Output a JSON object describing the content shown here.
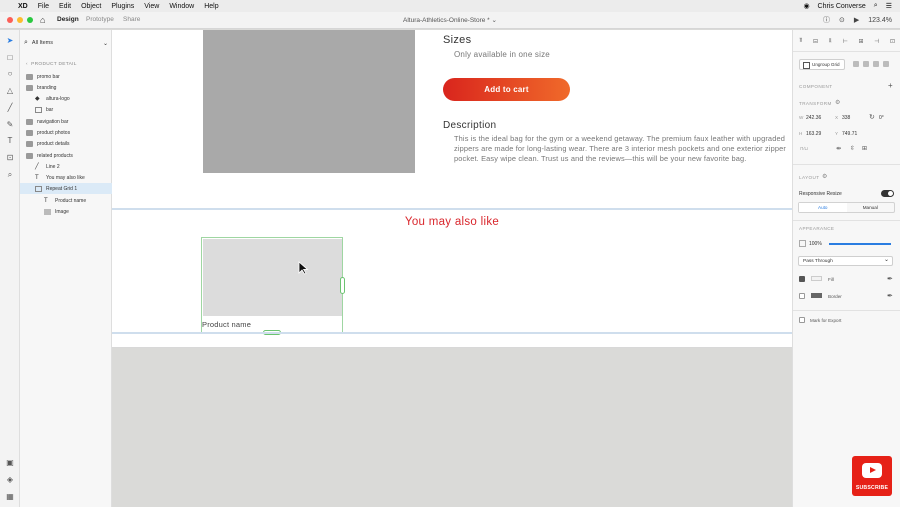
{
  "menubar": {
    "app": "XD",
    "items": [
      "File",
      "Edit",
      "Object",
      "Plugins",
      "View",
      "Window",
      "Help"
    ],
    "user": "Chris Converse"
  },
  "toolbar": {
    "tabs": [
      "Design",
      "Prototype",
      "Share"
    ],
    "document_title": "Altura-Athletics-Online-Store *",
    "zoom": "123.4%"
  },
  "layers": {
    "filter": "All Items",
    "section": "PRODUCT DETAIL",
    "items": [
      {
        "label": "promo bar",
        "type": "folder"
      },
      {
        "label": "branding",
        "type": "folder"
      },
      {
        "label": "altura-logo",
        "type": "symbol"
      },
      {
        "label": "bar",
        "type": "grid"
      },
      {
        "label": "navigation bar",
        "type": "folder"
      },
      {
        "label": "product photos",
        "type": "folder"
      },
      {
        "label": "product details",
        "type": "folder"
      },
      {
        "label": "related products",
        "type": "folder"
      },
      {
        "label": "Line 2",
        "type": "line"
      },
      {
        "label": "You may also like",
        "type": "text"
      },
      {
        "label": "Repeat Grid 1",
        "type": "grid"
      },
      {
        "label": "Product name",
        "type": "text"
      },
      {
        "label": "Image",
        "type": "image"
      }
    ]
  },
  "canvas": {
    "sizes_heading": "Sizes",
    "sizes_text": "Only available in one size",
    "cart_button": "Add to cart",
    "description_heading": "Description",
    "description_text": "This is the ideal bag for the gym or a weekend getaway.  The premium faux leather with upgraded zippers are made for long-lasting wear. There are 3 interior mesh pockets and one exterior zipper pocket. Easy wipe clean. Trust us and the reviews—this will be your new favorite bag.",
    "related_heading": "You may also like",
    "product_name": "Product name"
  },
  "props": {
    "ungroup_label": "Ungroup Grid",
    "component_label": "COMPONENT",
    "transform_label": "TRANSFORM",
    "w": "242.36",
    "x": "338",
    "rotation": "0°",
    "h": "163.29",
    "y": "749.71",
    "layout_label": "LAYOUT",
    "responsive_label": "Responsive Resize",
    "seg_auto": "Auto",
    "seg_manual": "Manual",
    "appearance_label": "APPEARANCE",
    "opacity": "100%",
    "blend": "Pass Through",
    "fill_label": "Fill",
    "border_label": "Border",
    "export_label": "Mark for Export"
  },
  "badge": {
    "subscribe": "SUBSCRIBE"
  },
  "colors": {
    "accent": "#2a7de1",
    "cta_start": "#d9251d",
    "cta_end": "#f06a2a",
    "heading_red": "#d9262c"
  }
}
